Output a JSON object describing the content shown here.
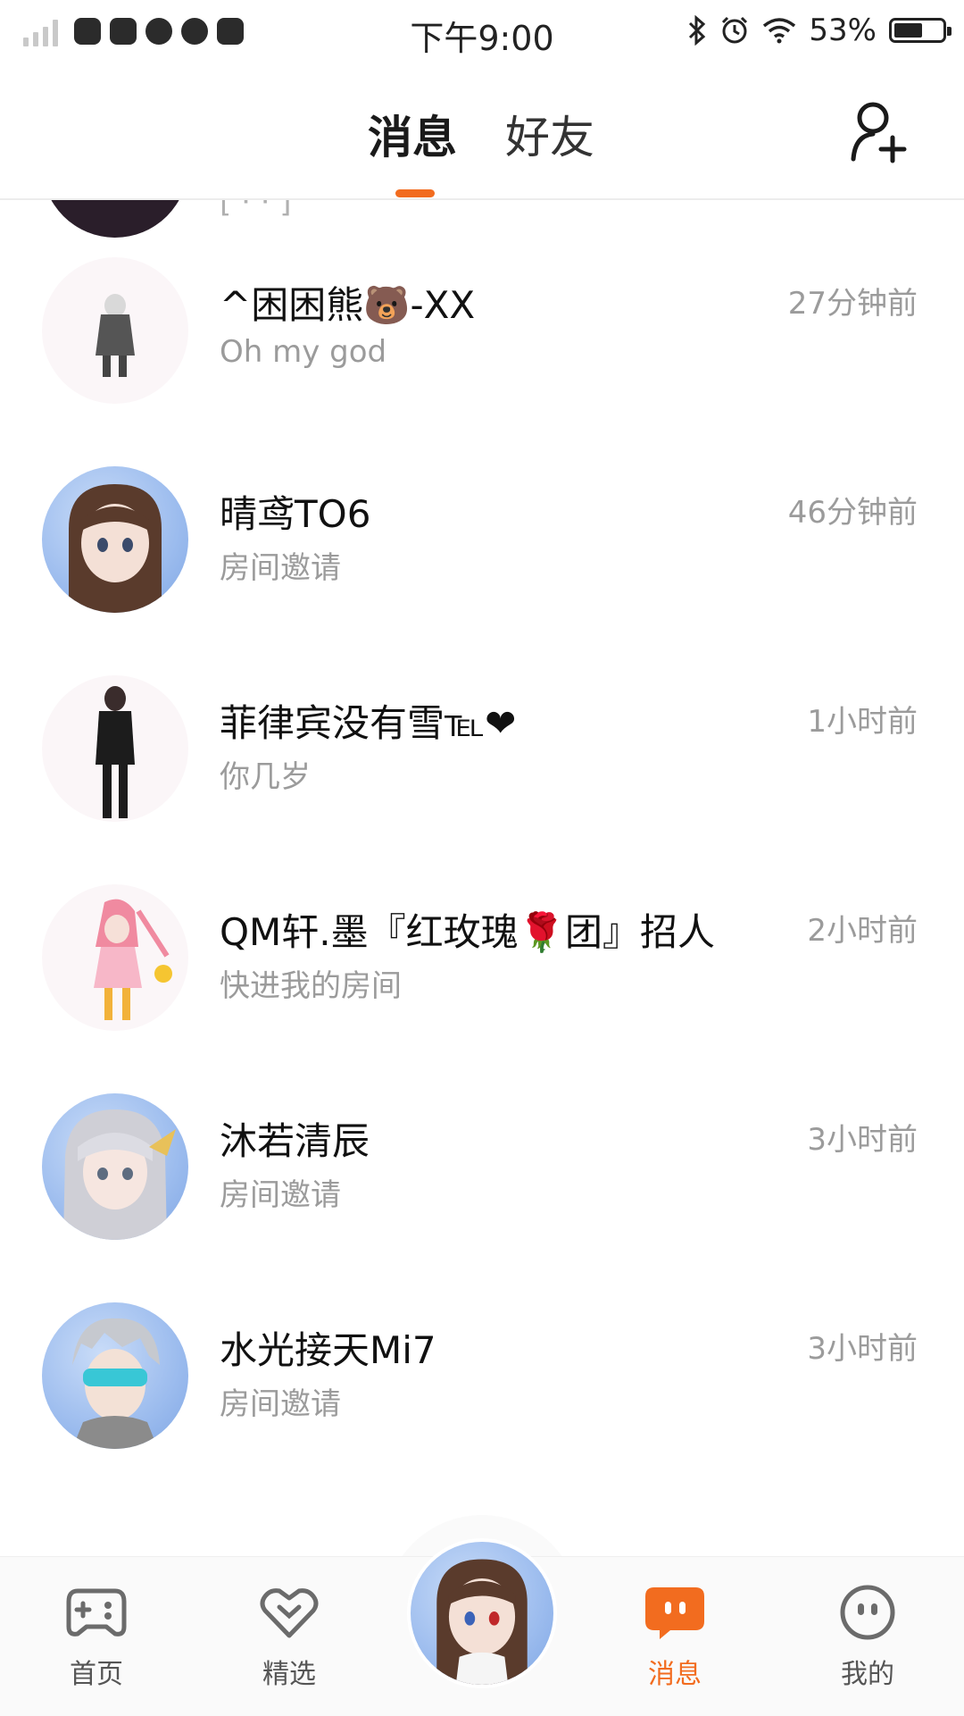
{
  "status_bar": {
    "time": "下午9:00",
    "battery": "53%",
    "battery_level": 0.53,
    "icons": [
      "signal-icon",
      "music-app-icon",
      "app-icon",
      "globe-app-icon",
      "pinwheel-app-icon",
      "play-app-icon",
      "bluetooth-icon",
      "alarm-icon",
      "wifi-icon",
      "battery-icon"
    ]
  },
  "header": {
    "tabs": [
      {
        "label": "消息",
        "active": true
      },
      {
        "label": "好友",
        "active": false
      }
    ],
    "accent": "#f26c1f",
    "add_friend_icon": "add-friend-icon"
  },
  "conversations": [
    {
      "name": "^困困熊🐻-XX",
      "preview": "Oh my god",
      "time": "27分钟前"
    },
    {
      "name": "晴鸢TO6",
      "preview": "房间邀请",
      "time": "46分钟前"
    },
    {
      "name": "菲律宾没有雪℡❤",
      "preview": "你几岁",
      "time": "1小时前"
    },
    {
      "name": "QM轩.墨『红玫瑰🌹团』招人",
      "preview": "快进我的房间",
      "time": "2小时前"
    },
    {
      "name": "沐若清辰",
      "preview": "房间邀请",
      "time": "3小时前"
    },
    {
      "name": "水光接天Mi7",
      "preview": "房间邀请",
      "time": "3小时前"
    }
  ],
  "bottom_nav": [
    {
      "label": "首页",
      "icon": "gamepad-icon",
      "active": false
    },
    {
      "label": "精选",
      "icon": "heart-icon",
      "active": false
    },
    {
      "label": "消息",
      "icon": "message-icon",
      "active": true
    },
    {
      "label": "我的",
      "icon": "face-icon",
      "active": false
    }
  ]
}
